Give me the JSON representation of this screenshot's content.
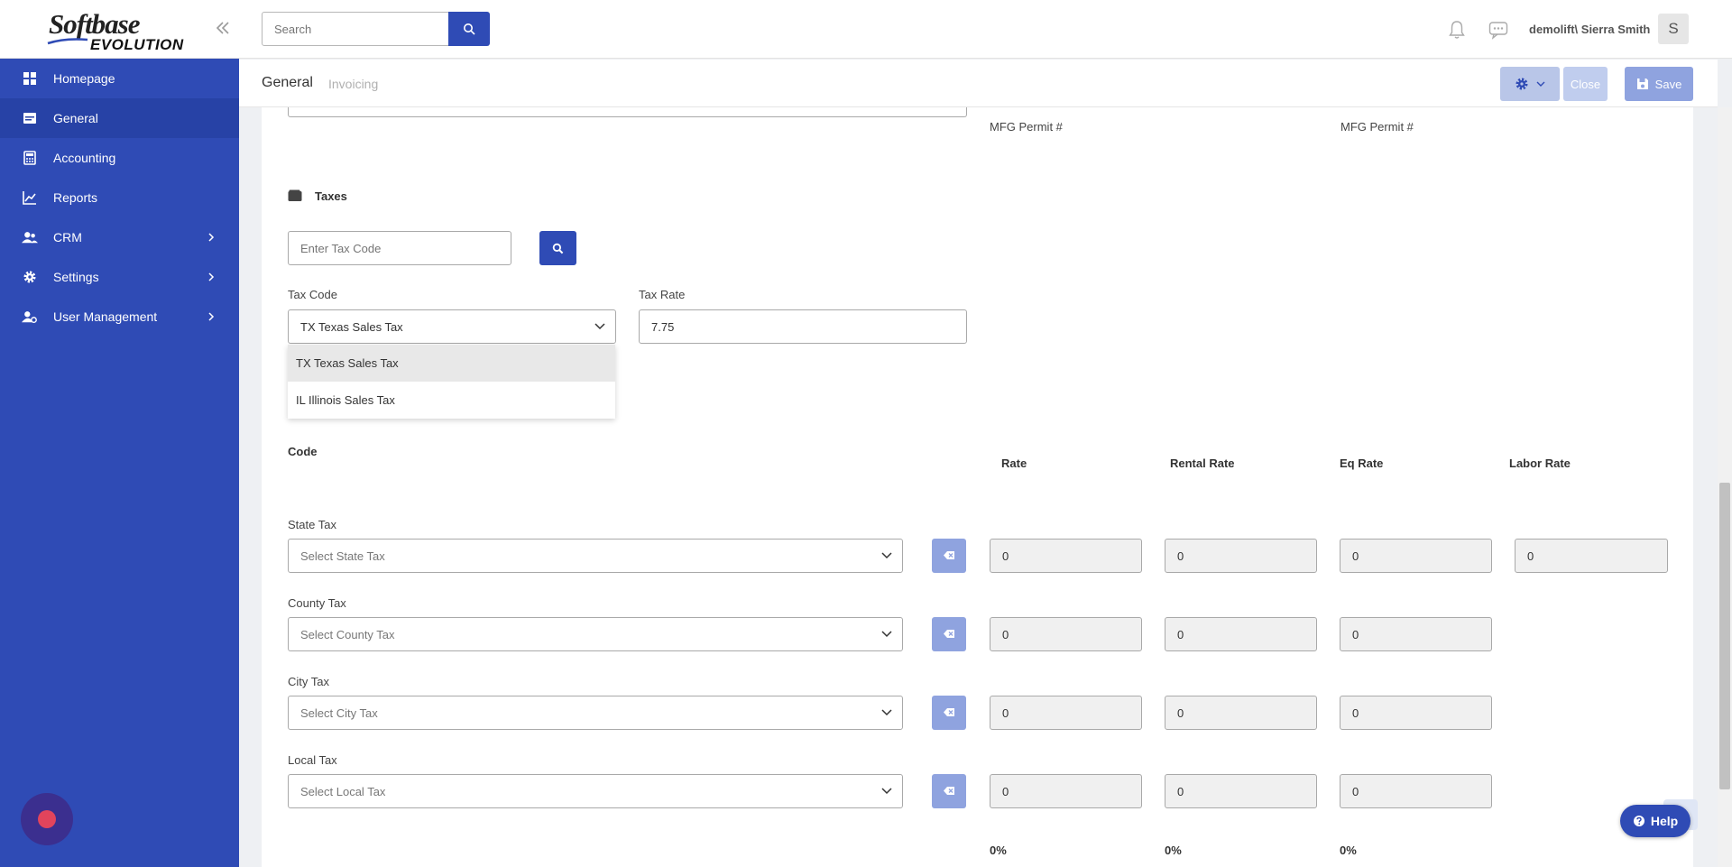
{
  "sidebar": {
    "logo_top": "Softbase",
    "logo_bottom": "EVOLUTION",
    "items": [
      {
        "label": "Homepage",
        "icon": "homepage-icon"
      },
      {
        "label": "General",
        "icon": "general-icon"
      },
      {
        "label": "Accounting",
        "icon": "calculator-icon"
      },
      {
        "label": "Reports",
        "icon": "chart-icon"
      },
      {
        "label": "CRM",
        "icon": "users-icon"
      },
      {
        "label": "Settings",
        "icon": "gear-icon"
      },
      {
        "label": "User Management",
        "icon": "user-gear-icon"
      }
    ]
  },
  "header": {
    "search_placeholder": "Search",
    "username": "demolift\\ Sierra Smith",
    "avatar_initial": "S"
  },
  "subheader": {
    "tabs": [
      "General",
      "Invoicing"
    ],
    "close_label": "Close",
    "save_label": "Save"
  },
  "form": {
    "mfg_permit_label_1": "MFG Permit #",
    "mfg_permit_label_2": "MFG Permit #",
    "taxes_title": "Taxes",
    "tax_code_search_placeholder": "Enter Tax Code",
    "tax_code_label": "Tax Code",
    "tax_code_value": "TX Texas Sales Tax",
    "tax_rate_label": "Tax Rate",
    "tax_rate_value": "7.75",
    "tax_code_options": [
      "TX Texas Sales Tax",
      "IL Illinois Sales Tax"
    ],
    "code_header": "Code",
    "rate_header": "Rate",
    "rental_rate_header": "Rental Rate",
    "eq_rate_header": "Eq Rate",
    "labor_rate_header": "Labor Rate",
    "rows": [
      {
        "label": "State Tax",
        "placeholder": "Select State Tax",
        "rate": "0",
        "rental": "0",
        "eq": "0",
        "labor": "0"
      },
      {
        "label": "County Tax",
        "placeholder": "Select County Tax",
        "rate": "0",
        "rental": "0",
        "eq": "0"
      },
      {
        "label": "City Tax",
        "placeholder": "Select City Tax",
        "rate": "0",
        "rental": "0",
        "eq": "0"
      },
      {
        "label": "Local Tax",
        "placeholder": "Select Local Tax",
        "rate": "0",
        "rental": "0",
        "eq": "0"
      }
    ],
    "totals": [
      "0%",
      "0%",
      "0%"
    ]
  },
  "help_label": "Help",
  "colors": {
    "sidebar": "#2f4bb5",
    "active_item": "#2742a6",
    "primary_button": "#2f4bb5",
    "disabled_button": "#8fa3df"
  }
}
